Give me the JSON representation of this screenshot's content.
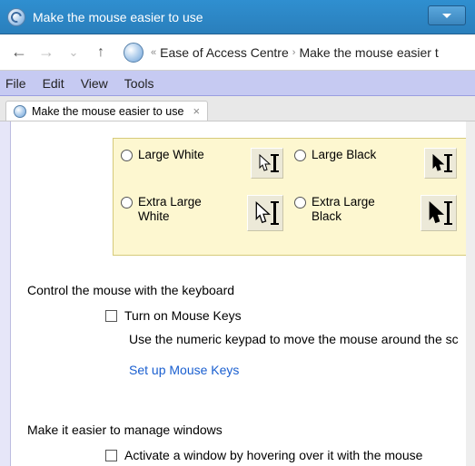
{
  "window": {
    "title": "Make the mouse easier to use"
  },
  "breadcrumb": {
    "part1": "Ease of Access Centre",
    "part2": "Make the mouse easier t"
  },
  "menu": {
    "file": "File",
    "edit": "Edit",
    "view": "View",
    "tools": "Tools"
  },
  "tab": {
    "label": "Make the mouse easier to use"
  },
  "pointer_schemes": {
    "large_white": "Large White",
    "large_black": "Large Black",
    "extra_large_white": "Extra Large White",
    "extra_large_black": "Extra Large Black"
  },
  "keyboard_section": {
    "title": "Control the mouse with the keyboard",
    "checkbox_label": "Turn on Mouse Keys",
    "helper": "Use the numeric keypad to move the mouse around the sc",
    "link": "Set up Mouse Keys"
  },
  "windows_section": {
    "title": "Make it easier to manage windows",
    "checkbox_label": "Activate a window by hovering over it with the mouse"
  }
}
